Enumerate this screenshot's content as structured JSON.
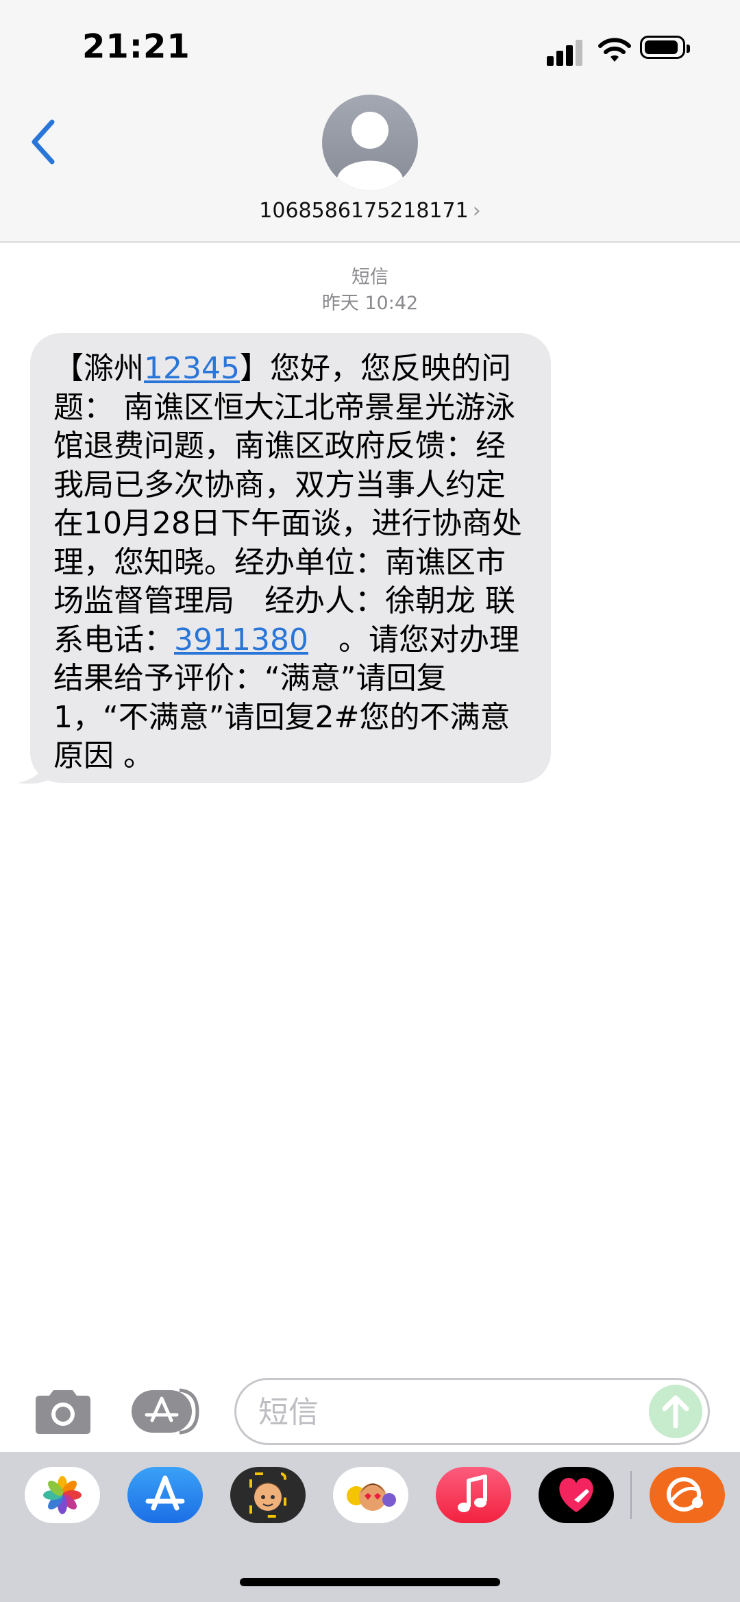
{
  "status_bar": {
    "time": "21:21"
  },
  "header": {
    "contact_number": "1068586175218171",
    "chevron": "›"
  },
  "conversation": {
    "service_label": "短信",
    "timestamp": "昨天 10:42",
    "message": {
      "p1": "【滁州",
      "link1": "12345",
      "p2": "】您好，您反映的问题： 南谯区恒大江北帝景星光游泳馆退费问题，南谯区政府反馈：经我局已多次协商，双方当事人约定在10月28日下午面谈，进行协商处理，您知晓。经办单位：南谯区市场监督管理局　经办人：徐朝龙 联系电话：",
      "link2": "3911380",
      "p3": "　。请您对办理结果给予评价：“满意”请回复1，“不满意”请回复2#您的不满意原因 。"
    }
  },
  "compose": {
    "placeholder": "短信",
    "value": ""
  },
  "icons": {
    "back": "chevron-left-icon",
    "avatar": "person-icon",
    "camera": "camera-icon",
    "apps": "app-store-icon",
    "send": "arrow-up-icon"
  },
  "drawer_apps": [
    "photos",
    "app-store",
    "memoji",
    "animoji-stickers",
    "music",
    "digital-touch",
    "hupu"
  ],
  "colors": {
    "accent": "#2a76d8",
    "bubble": "#e9e9eb",
    "header_bg": "#f6f6f6",
    "drawer_bg": "#d1d3d9",
    "send_disabled": "#c7ebcd"
  }
}
